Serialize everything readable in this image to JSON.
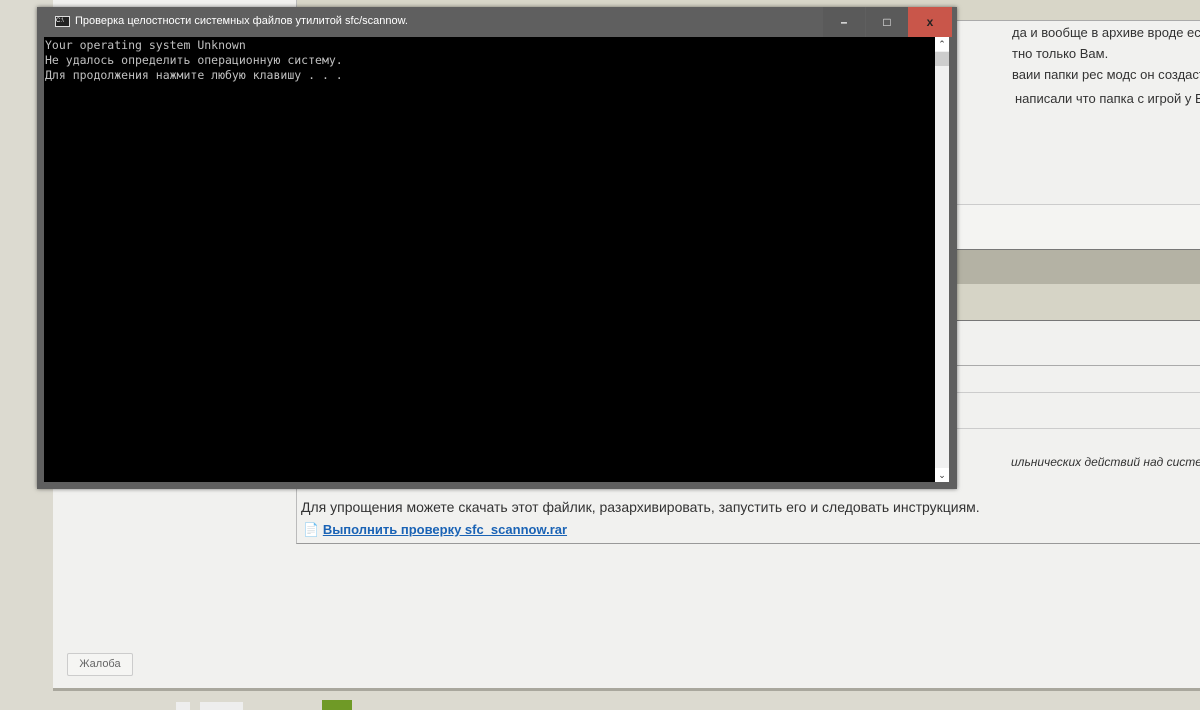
{
  "post": {
    "lines": [
      "да и вообще в архиве вроде есть файл",
      "тно только Вам.",
      "ваии папки рес модс он создаст ее и ус",
      "написали что папка с игрой у Вас одна"
    ],
    "italic_line": "ильнических действий над системой.",
    "instruction": "Для упрощения можете скачать этот файлик, разархивировать, запустить его и следовать инструкциям.",
    "attachment_link": "Выполнить проверку sfc_scannow.rar"
  },
  "report_button": "Жалоба",
  "console": {
    "title": "Проверка целостности системных файлов утилитой  sfc/scannow.",
    "lines": [
      "Your operating system Unknown",
      "Не удалось определить операционную систему.",
      "Для продолжения нажмите любую клавишу . . ."
    ],
    "minimize": "–",
    "maximize": "□",
    "close": "x"
  }
}
